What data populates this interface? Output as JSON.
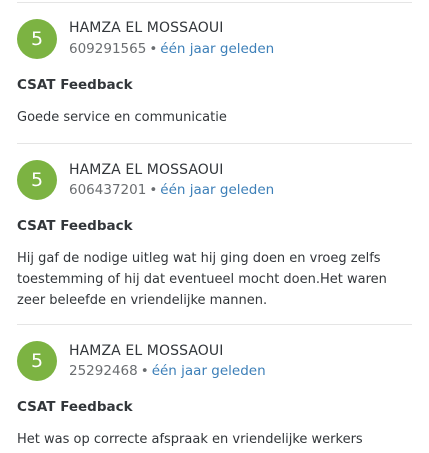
{
  "colors": {
    "avatar_bg": "#7cb342",
    "link": "#3c7fb8",
    "muted": "#6a6d70",
    "text": "#32363a",
    "divider": "#e5e5e5"
  },
  "entries": [
    {
      "avatar": "5",
      "author": "HAMZA EL MOSSAOUI",
      "ticket": "609291565",
      "separator": "•",
      "time_ago": "één jaar geleden",
      "title": "CSAT Feedback",
      "body": "Goede service en communicatie"
    },
    {
      "avatar": "5",
      "author": "HAMZA EL MOSSAOUI",
      "ticket": "606437201",
      "separator": "•",
      "time_ago": "één jaar geleden",
      "title": "CSAT Feedback",
      "body": "Hij gaf de nodige uitleg wat hij ging doen en vroeg zelfs toestemming of hij dat eventueel mocht doen.Het waren zeer beleefde en vriendelijke mannen."
    },
    {
      "avatar": "5",
      "author": "HAMZA EL MOSSAOUI",
      "ticket": "25292468",
      "separator": "•",
      "time_ago": "één jaar geleden",
      "title": "CSAT Feedback",
      "body": "Het was op correcte afspraak en vriendelijke werkers"
    }
  ]
}
